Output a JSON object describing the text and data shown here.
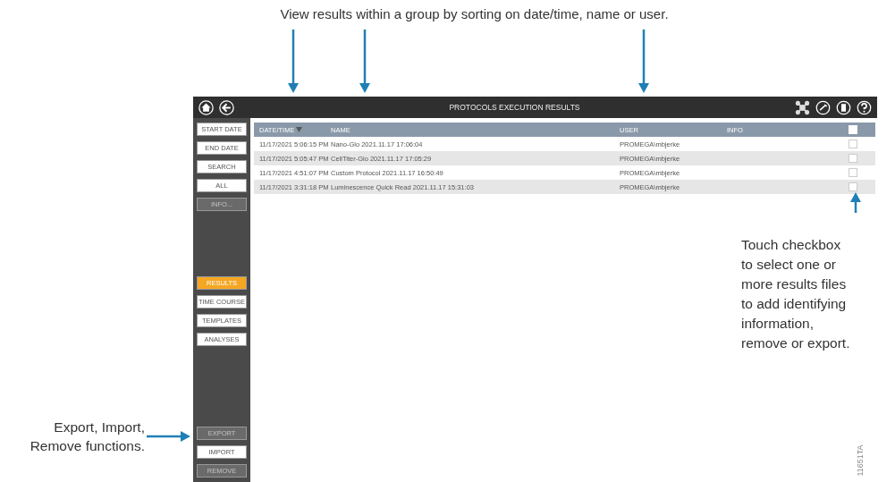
{
  "caption": "View results within a group by sorting on date/time, name or user.",
  "window": {
    "title": "PROTOCOLS EXECUTION RESULTS"
  },
  "sidebar": {
    "filter_buttons": [
      {
        "label": "START DATE",
        "disabled": false
      },
      {
        "label": "END DATE",
        "disabled": false
      },
      {
        "label": "SEARCH",
        "disabled": false
      },
      {
        "label": "ALL",
        "disabled": false
      },
      {
        "label": "INFO...",
        "disabled": true
      }
    ],
    "view_buttons": [
      {
        "label": "RESULTS",
        "selected": true
      },
      {
        "label": "TIME COURSE",
        "selected": false
      },
      {
        "label": "TEMPLATES",
        "selected": false
      },
      {
        "label": "ANALYSES",
        "selected": false
      }
    ],
    "file_buttons": [
      {
        "label": "EXPORT",
        "disabled": true
      },
      {
        "label": "IMPORT",
        "disabled": false
      },
      {
        "label": "REMOVE",
        "disabled": true
      }
    ]
  },
  "table": {
    "columns": [
      "DATE/TIME",
      "NAME",
      "USER",
      "INFO"
    ],
    "select_all_checked": false,
    "rows": [
      {
        "date_time": "11/17/2021 5:06:15 PM",
        "name": "Nano-Glo 2021.11.17 17:06:04",
        "user": "PROMEGA\\mbjerke",
        "checked": false
      },
      {
        "date_time": "11/17/2021 5:05:47 PM",
        "name": "CellTiter-Glo 2021.11.17 17:05:29",
        "user": "PROMEGA\\mbjerke",
        "checked": false
      },
      {
        "date_time": "11/17/2021 4:51:07 PM",
        "name": "Custom Protocol 2021.11.17 16:50:49",
        "user": "PROMEGA\\mbjerke",
        "checked": false
      },
      {
        "date_time": "11/17/2021 3:31:18 PM",
        "name": "Luminescence Quick Read 2021.11.17 15:31:03",
        "user": "PROMEGA\\mbjerke",
        "checked": false
      }
    ]
  },
  "callouts": {
    "checkbox": [
      "Touch checkbox",
      "to select one or",
      "more results files",
      "to add identifying",
      "information,",
      "remove or export."
    ],
    "functions": [
      "Export, Import,",
      "Remove functions."
    ]
  },
  "figure_id": "11651TA"
}
